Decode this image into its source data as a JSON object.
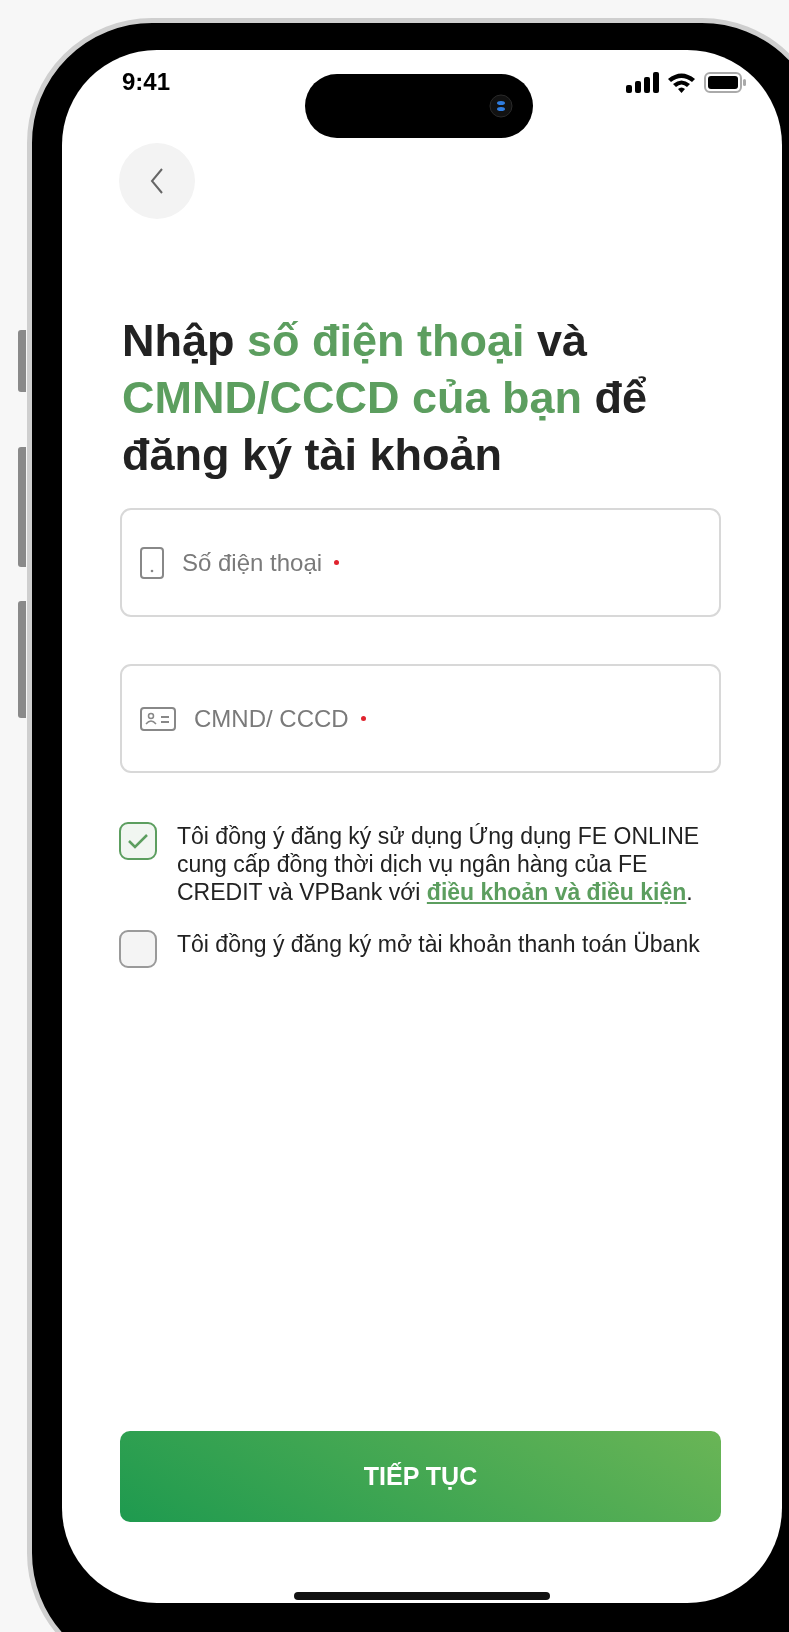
{
  "status_bar": {
    "time": "9:41"
  },
  "heading": [
    {
      "text": "Nhập ",
      "highlight": false
    },
    {
      "text": "số điện thoại",
      "highlight": true
    },
    {
      "text": " và ",
      "highlight": false
    },
    {
      "text": "CMND/CCCD của bạn",
      "highlight": true
    },
    {
      "text": " để đăng ký tài khoản",
      "highlight": false
    }
  ],
  "fields": [
    {
      "kind": "phone",
      "placeholder": "Số điện thoại",
      "required": true
    },
    {
      "kind": "id-card",
      "placeholder": "CMND/ CCCD",
      "required": true
    }
  ],
  "agreements": [
    {
      "checked": true,
      "text": "Tôi đồng ý đăng ký sử dụng Ứng dụng FE ONLINE cung cấp đồng thời dịch vụ ngân hàng của FE CREDIT và VPBank với ",
      "link": "điều khoản và điều kiện",
      "after": "."
    },
    {
      "checked": false,
      "text": "Tôi đồng ý đăng ký mở tài khoản thanh toán Übank"
    }
  ],
  "button": {
    "label": "TIẾP TỤC"
  }
}
